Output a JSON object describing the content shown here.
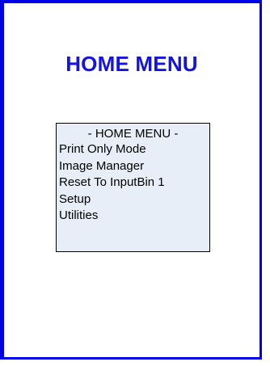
{
  "page": {
    "title": "HOME MENU"
  },
  "menu": {
    "header": "- HOME MENU -",
    "items": [
      {
        "label": "Print Only Mode"
      },
      {
        "label": "Image Manager"
      },
      {
        "label": "Reset To InputBin 1"
      },
      {
        "label": "Setup"
      },
      {
        "label": "Utilities"
      }
    ]
  },
  "colors": {
    "accent": "#0000e6",
    "title": "#1414e0",
    "menu_background": "#e7eef8"
  }
}
